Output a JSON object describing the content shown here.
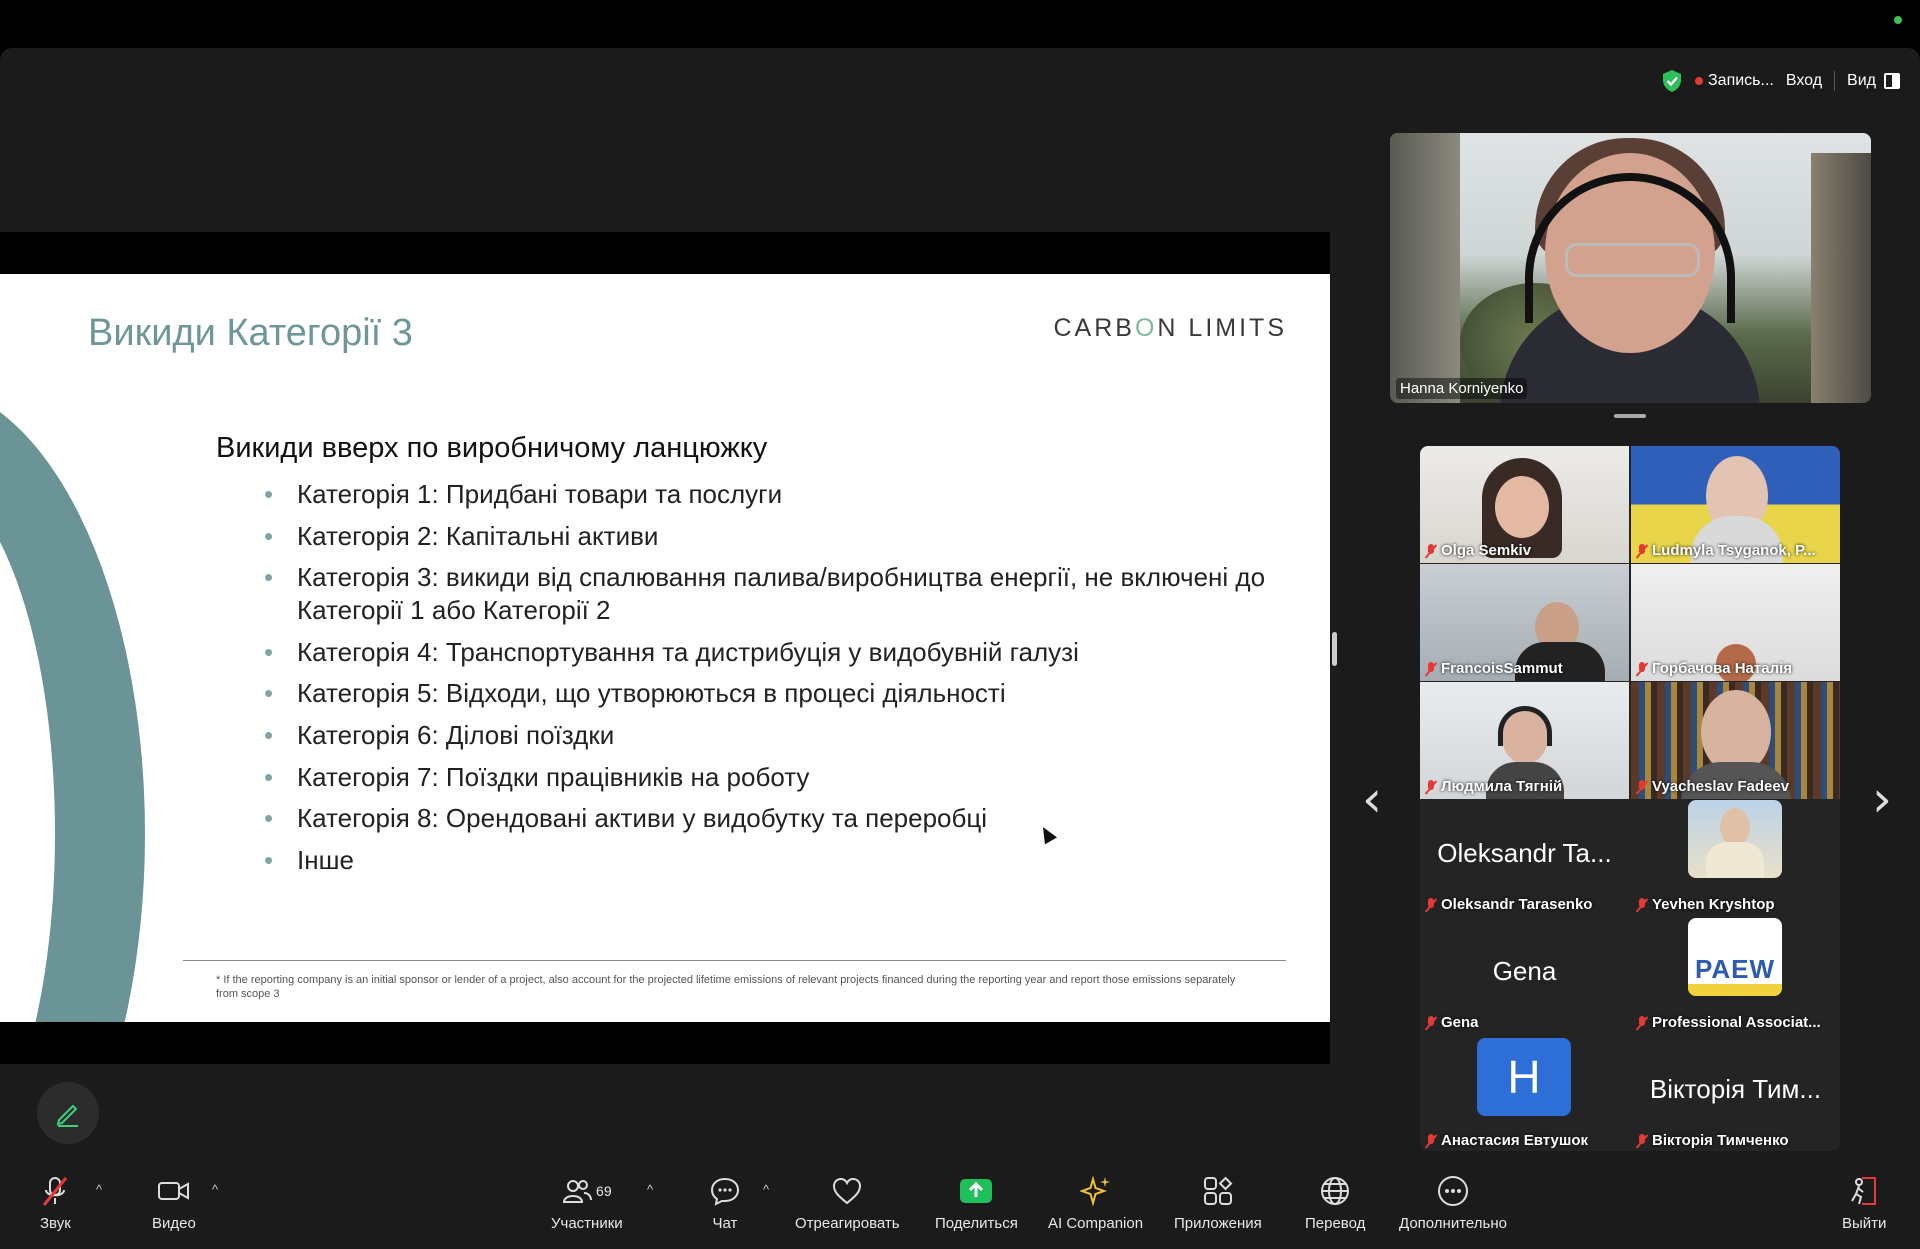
{
  "topbar": {
    "record_label": "Запись...",
    "login_label": "Вход",
    "view_label": "Вид"
  },
  "slide": {
    "title": "Викиди Категорії 3",
    "logo_text_a": "CARB",
    "logo_text_o": "O",
    "logo_text_b": "N LIMITS",
    "subheading": "Викиди вверх по виробничому ланцюжку",
    "bullets": [
      "Категорія 1: Придбані товари та послуги",
      "Категорія 2: Капітальні активи",
      "Категорія 3: викиди від спалювання палива/виробництва енергії, не включені до Категорії 1 або Категорії 2",
      "Категорія 4: Транспортування та дистрибуція у видобувній галузі",
      "Категорія 5: Відходи, що утворюються в процесі діяльності",
      "Категорія 6: Ділові поїздки",
      "Категорія 7: Поїздки працівників на роботу",
      "Категорія 8: Орендовані активи у видобутку та переробці",
      "Інше"
    ],
    "footnote": "* If the reporting company is an initial sponsor or lender of a project, also account for the projected lifetime emissions of relevant projects financed during the reporting year and report those emissions separately from scope 3"
  },
  "speaker": {
    "name": "Hanna Korniyenko"
  },
  "gallery": {
    "tiles": [
      {
        "name": "Olga Semkiv"
      },
      {
        "name": "Ludmyla Tsyganok, P..."
      },
      {
        "name": "FrancoisSammut"
      },
      {
        "name": "Горбачова Наталія"
      },
      {
        "name": "Людмила Тягній"
      },
      {
        "name": "Vyacheslav Fadeev"
      },
      {
        "name": "Oleksandr Tarasenko",
        "display": "Oleksandr Ta..."
      },
      {
        "name": "Yevhen Kryshtop"
      },
      {
        "name": "Gena",
        "display": "Gena"
      },
      {
        "name": "Professional Associat...",
        "avatar_text": "PAEW"
      },
      {
        "name": "Анастасия Евтушок",
        "avatar_letter": "H"
      },
      {
        "name": "Вікторія Тимченко",
        "display": "Вікторія Тим..."
      }
    ]
  },
  "toolbar": {
    "audio": "Звук",
    "video": "Видео",
    "participants": "Участники",
    "participants_count": "69",
    "chat": "Чат",
    "react": "Отреагировать",
    "share": "Поделиться",
    "ai": "AI Companion",
    "apps": "Приложения",
    "translate": "Перевод",
    "more": "Дополнительно",
    "leave": "Выйти"
  },
  "colors": {
    "accent_green": "#3fbf5a",
    "share_green": "#1fbf5a",
    "mute_red": "#e53935",
    "slide_teal": "#6a9496"
  }
}
